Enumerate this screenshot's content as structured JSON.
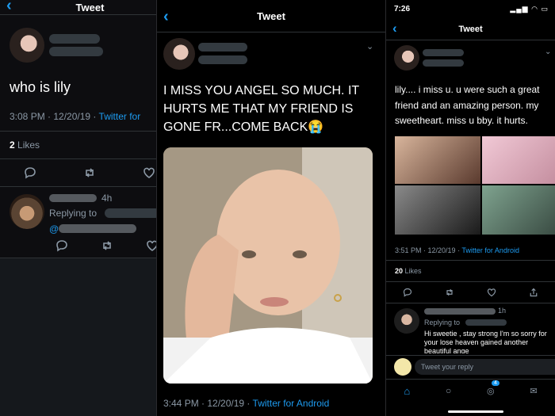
{
  "panel1": {
    "header_title": "Tweet",
    "tweet_text": "who is lily",
    "time": "3:08 PM",
    "date": "12/20/19",
    "source": "Twitter for",
    "likes_count": "2",
    "likes_label": "Likes",
    "reply": {
      "time": "4h",
      "replying_to": "Replying to",
      "mention": "@"
    }
  },
  "panel2": {
    "header_title": "Tweet",
    "tweet_text": "I MISS YOU ANGEL SO MUCH. IT HURTS ME THAT MY FRIEND IS GONE FR...COME BACK😭",
    "time": "3:44 PM",
    "date": "12/20/19",
    "source": "Twitter for Android"
  },
  "panel3": {
    "status_time": "7:26",
    "header_title": "Tweet",
    "tweet_text": "lily.... i miss u. u were such a great friend and an amazing person. my sweetheart. miss u bby. it hurts.",
    "time": "3:51 PM",
    "date": "12/20/19",
    "source": "Twitter for Android",
    "likes_count": "20",
    "likes_label": "Likes",
    "reply": {
      "time": "1h",
      "replying_to": "Replying to",
      "text": "Hi sweetie , stay strong I'm so sorry for your lose heaven gained another beautiful ange"
    },
    "composer_placeholder": "Tweet your reply",
    "notification_badge": "4"
  },
  "colors": {
    "accent": "#1d9bf0",
    "muted": "#8b98a5"
  }
}
